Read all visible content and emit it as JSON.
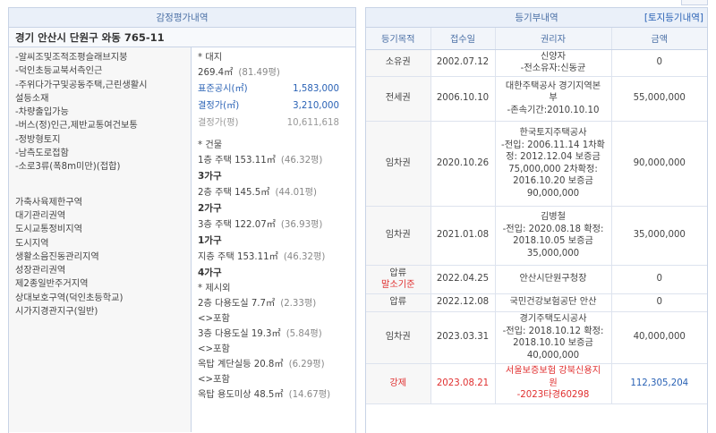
{
  "top_corner": "",
  "left": {
    "title": "감정평가내역",
    "address": "경기 안산시 단원구 와동 765-11",
    "location_notes": [
      "-알씨조및조적조평슬래브지붕",
      "-덕인초등교북서측인근",
      "-주위다가구및공동주택,근린생활시",
      "설등소재",
      "-차량출입가능",
      "-버스(정)인근,제반교통여건보통",
      "-정방형토지",
      "-남측도로접함",
      "-소로3류(폭8m미만)(접합)"
    ],
    "zoning": [
      "가축사육제한구역",
      "대기관리권역",
      "도시교통정비지역",
      "도시지역",
      "생활소음진동관리지역",
      "성장관리권역",
      "제2종일반주거지역",
      "상대보호구역(덕인초등학교)",
      "시가지경관지구(일반)"
    ],
    "land": {
      "header": "* 대지",
      "area": "269.4㎡",
      "area_pyeong": "(81.49평)",
      "public_price_label": "표준공시(㎡)",
      "public_price": "1,583,000",
      "appraised_label": "결정가(㎡)",
      "appraised": "3,210,000",
      "appraised_py_label": "결정가(평)",
      "appraised_py": "10,611,618"
    },
    "building": {
      "header": "* 건물",
      "floors": [
        {
          "desc": "1층 주택 153.11㎡",
          "pyeong": "(46.32평)",
          "family": "3가구"
        },
        {
          "desc": "2층 주택 145.5㎡",
          "pyeong": "(44.01평)",
          "family": "2가구"
        },
        {
          "desc": "3층 주택 122.07㎡",
          "pyeong": "(36.93평)",
          "family": "1가구"
        },
        {
          "desc": "지층 주택 153.11㎡",
          "pyeong": "(46.32평)",
          "family": "4가구"
        }
      ]
    },
    "excluded": {
      "header": "* 제시외",
      "items": [
        {
          "desc": "2층 다용도실 7.7㎡",
          "pyeong": "(2.33평)",
          "note": "<>포함"
        },
        {
          "desc": "3층 다용도실 19.3㎡",
          "pyeong": "(5.84평)",
          "note": "<>포함"
        },
        {
          "desc": "옥탑 계단실등 20.8㎡",
          "pyeong": "(6.29평)",
          "note": "<>포함"
        },
        {
          "desc": "옥탑 용도미상 48.5㎡",
          "pyeong": "(14.67평)",
          "note": ""
        }
      ]
    }
  },
  "right": {
    "title": "등기부내역",
    "link": "[토지등기내역]",
    "columns": [
      "등기목적",
      "접수일",
      "권리자",
      "금액"
    ],
    "rows": [
      {
        "purpose": "소유권",
        "purpose_note": "",
        "date": "2002.07.12",
        "holder": [
          "신양자",
          "-전소유자:신동균"
        ],
        "amount": "0",
        "highlight": false
      },
      {
        "purpose": "전세권",
        "purpose_note": "",
        "date": "2006.10.10",
        "holder": [
          "대한주택공사 경기지역본",
          "부",
          "-존속기간:2010.10.10"
        ],
        "amount": "55,000,000",
        "highlight": false
      },
      {
        "purpose": "임차권",
        "purpose_note": "",
        "date": "2020.10.26",
        "holder": [
          "한국토지주택공사",
          "-전입: 2006.11.14 1차확",
          "정: 2012.12.04 보증금",
          "75,000,000 2차확정:",
          "2016.10.20 보증금",
          "90,000,000"
        ],
        "amount": "90,000,000",
        "highlight": false
      },
      {
        "purpose": "임차권",
        "purpose_note": "",
        "date": "2021.01.08",
        "holder": [
          "김병철",
          "-전입: 2020.08.18 확정:",
          "2018.10.05 보증금",
          "35,000,000"
        ],
        "amount": "35,000,000",
        "highlight": false
      },
      {
        "purpose": "압류",
        "purpose_note": "말소기준",
        "date": "2022.04.25",
        "holder": [
          "안산시단원구청장"
        ],
        "amount": "0",
        "highlight": false
      },
      {
        "purpose": "압류",
        "purpose_note": "",
        "date": "2022.12.08",
        "holder": [
          "국민건강보험공단 안산"
        ],
        "amount": "0",
        "highlight": false
      },
      {
        "purpose": "임차권",
        "purpose_note": "",
        "date": "2023.03.31",
        "holder": [
          "경기주택도시공사",
          "-전입: 2018.10.12 확정:",
          "2018.10.10 보증금",
          "40,000,000"
        ],
        "amount": "40,000,000",
        "highlight": false
      },
      {
        "purpose": "강제",
        "purpose_note": "",
        "date": "2023.08.21",
        "holder": [
          "서울보증보험 강북신용지",
          "원",
          "-2023타경60298"
        ],
        "amount": "112,305,204",
        "highlight": true
      }
    ]
  },
  "colors": {
    "header_bg": "#eaf0f9",
    "header_text": "#4a6fa5",
    "link": "#2a62b5",
    "highlight": "#e03030"
  }
}
